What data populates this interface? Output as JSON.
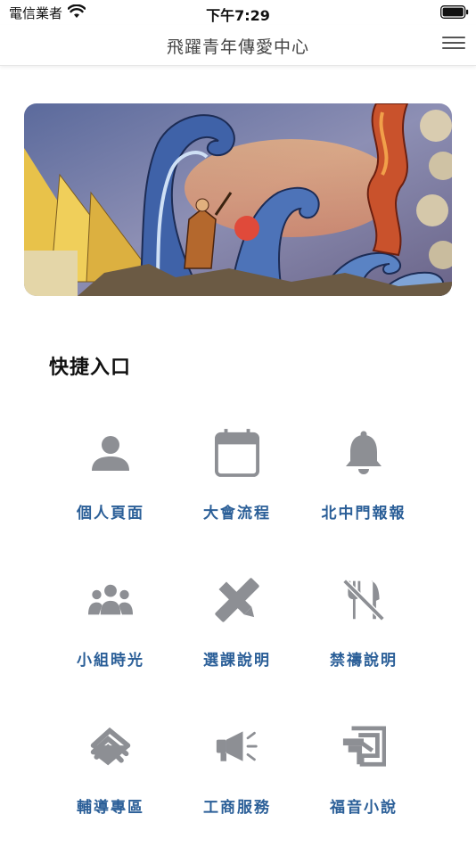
{
  "status_bar": {
    "carrier": "電信業者",
    "time": "下午7:29"
  },
  "nav": {
    "title": "飛躍青年傳愛中心"
  },
  "section": {
    "title": "快捷入口"
  },
  "shortcuts": [
    {
      "label": "個人頁面",
      "icon": "person-icon"
    },
    {
      "label": "大會流程",
      "icon": "calendar-icon"
    },
    {
      "label": "北中門報報",
      "icon": "bell-icon"
    },
    {
      "label": "小組時光",
      "icon": "group-icon"
    },
    {
      "label": "選課說明",
      "icon": "pencil-ruler-icon"
    },
    {
      "label": "禁禱說明",
      "icon": "no-utensils-icon"
    },
    {
      "label": "輔導專區",
      "icon": "hands-icon"
    },
    {
      "label": "工商服務",
      "icon": "megaphone-icon"
    },
    {
      "label": "福音小說",
      "icon": "sign-icon"
    }
  ],
  "colors": {
    "label": "#2b5f98",
    "icon": "#8d8f94"
  }
}
